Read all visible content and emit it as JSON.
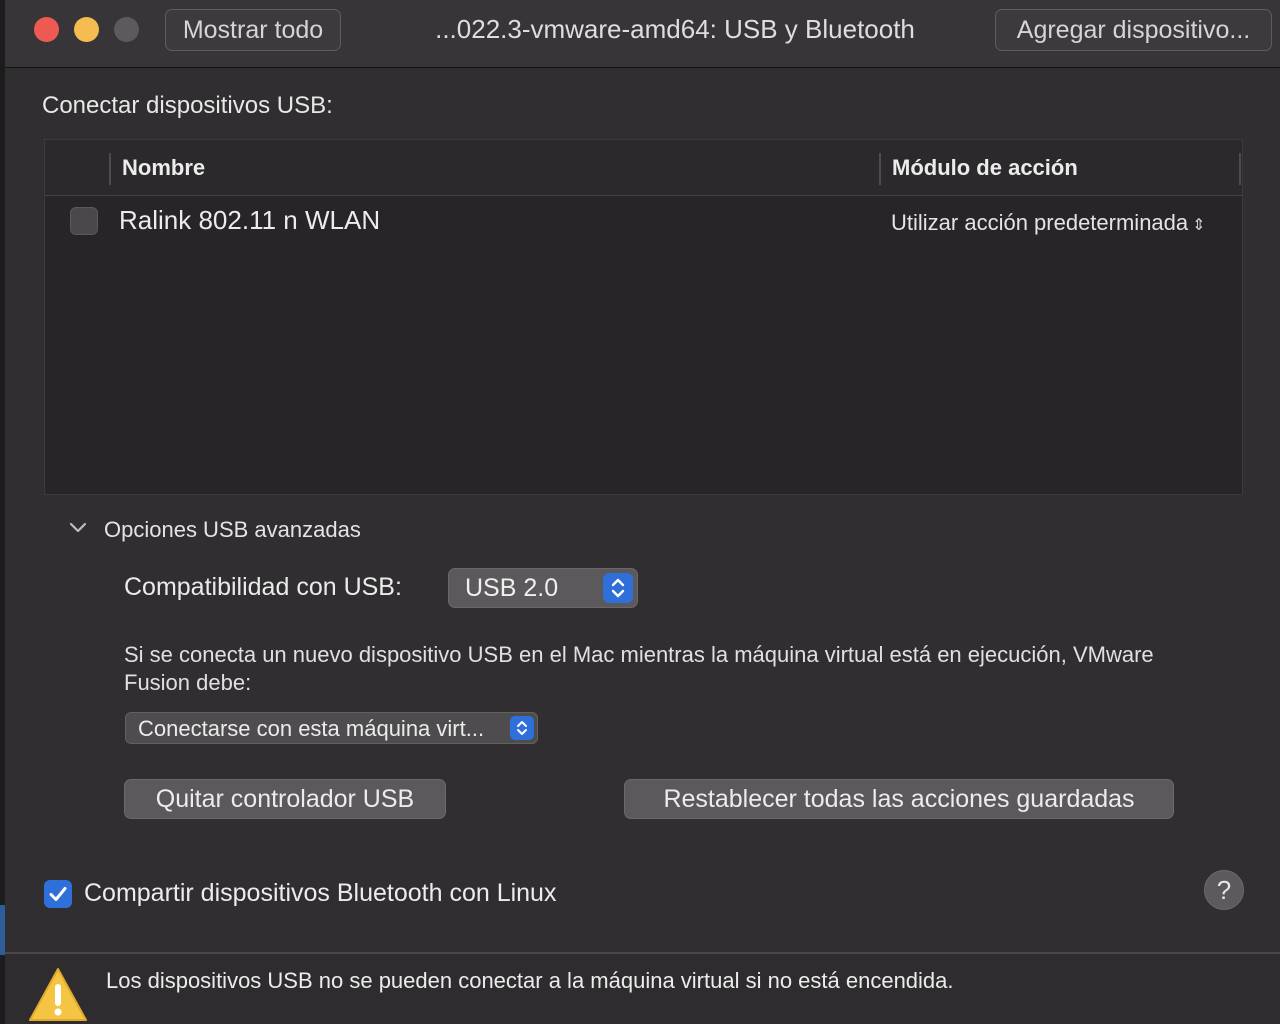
{
  "titlebar": {
    "show_all": "Mostrar todo",
    "title": "...022.3-vmware-amd64: USB y Bluetooth",
    "add_device": "Agregar dispositivo..."
  },
  "usb": {
    "section_title": "Conectar dispositivos USB:",
    "columns": [
      "Nombre",
      "Módulo de acción"
    ],
    "devices": [
      {
        "name": "Ralink 802.11 n WLAN",
        "action": "Utilizar acción predeterminada",
        "checked": false
      }
    ]
  },
  "advanced": {
    "label": "Opciones USB avanzadas",
    "compat_label": "Compatibilidad con USB:",
    "compat_value": "USB 2.0",
    "description": "Si se conecta un nuevo dispositivo USB en el Mac mientras la máquina virtual está en ejecución, VMware Fusion debe:",
    "policy_value": "Conectarse con esta máquina virt...",
    "remove_button": "Quitar controlador USB",
    "reset_button": "Restablecer todas las acciones guardadas"
  },
  "bluetooth": {
    "label": "Compartir dispositivos Bluetooth con Linux",
    "checked": true
  },
  "help": "?",
  "footer": {
    "warning": "Los dispositivos USB no se pueden conectar a la máquina virtual si no está encendida."
  },
  "colors": {
    "accent": "#2f6fd9",
    "close": "#ee5a52",
    "minimize": "#f5bd4f",
    "warning": "#f4c542"
  }
}
